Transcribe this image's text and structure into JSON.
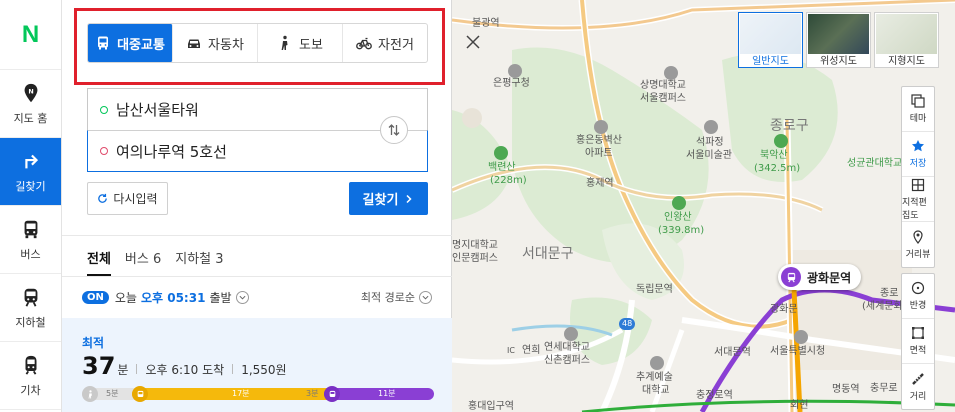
{
  "nav": {
    "logo": "N",
    "items": [
      {
        "label": "지도 홈",
        "icon": "map-pin-icon",
        "active": false
      },
      {
        "label": "길찾기",
        "icon": "directions-arrow-icon",
        "active": true
      },
      {
        "label": "버스",
        "icon": "bus-icon",
        "active": false
      },
      {
        "label": "지하철",
        "icon": "subway-icon",
        "active": false
      },
      {
        "label": "기차",
        "icon": "train-icon",
        "active": false
      }
    ]
  },
  "modes": [
    {
      "label": "대중교통",
      "icon": "bus-icon",
      "active": true
    },
    {
      "label": "자동차",
      "icon": "car-icon",
      "active": false
    },
    {
      "label": "도보",
      "icon": "walk-icon",
      "active": false
    },
    {
      "label": "자전거",
      "icon": "bicycle-icon",
      "active": false
    }
  ],
  "route": {
    "start": "남산서울타워",
    "goal": "여의나루역 5호선",
    "reset_label": "다시입력",
    "search_label": "길찾기"
  },
  "result_tabs": [
    {
      "label": "전체",
      "active": true
    },
    {
      "label": "버스 6",
      "active": false
    },
    {
      "label": "지하철 3",
      "active": false
    }
  ],
  "departure": {
    "badge": "ON",
    "prefix": "오늘",
    "time": "오후 05:31",
    "suffix": "출발",
    "sort_label": "최적 경로순"
  },
  "best_route": {
    "label": "최적",
    "minutes": "37",
    "minutes_unit": "분",
    "arrival": "오후 6:10 도착",
    "fare": "1,550원",
    "segments": [
      {
        "type": "walk",
        "label": "5분"
      },
      {
        "type": "bus",
        "label": "17분"
      },
      {
        "type": "walk",
        "label": "3분"
      },
      {
        "type": "subway",
        "label": "11분"
      }
    ]
  },
  "map": {
    "types": [
      {
        "label": "일반지도",
        "active": true
      },
      {
        "label": "위성지도",
        "active": false
      },
      {
        "label": "지형지도",
        "active": false
      }
    ],
    "tools_group1": [
      {
        "label": "테마",
        "icon": "layers-icon"
      },
      {
        "label": "저장",
        "icon": "star-icon"
      },
      {
        "label": "지적편집도",
        "icon": "cadastral-icon"
      },
      {
        "label": "거리뷰",
        "icon": "street-view-icon"
      }
    ],
    "tools_group2": [
      {
        "label": "반경",
        "icon": "radius-icon"
      },
      {
        "label": "면적",
        "icon": "area-icon"
      },
      {
        "label": "거리",
        "icon": "ruler-icon"
      }
    ],
    "station_pin": "광화문역",
    "labels": {
      "l01": "불광역",
      "l02": "은평구청",
      "l03": "상명대학교",
      "l04": "서울캠퍼스",
      "l05": "종로구",
      "l06": "홍은동벽산",
      "l07": "아파트",
      "l08": "석파정",
      "l09": "서울미술관",
      "l10": "북악산",
      "l11": "(342.5m)",
      "l12": "성균관대학교",
      "l13": "백련산",
      "l14": "(228m)",
      "l15": "홍제역",
      "l16": "인왕산",
      "l17": "(339.8m)",
      "l18": "서대문구",
      "l19": "명지대학교",
      "l20": "인문캠퍼스",
      "l21": "독립문역",
      "l22": "광화문",
      "l23": "종로",
      "l24": "(세계문화",
      "l25": "연세대학교",
      "l26": "신촌캠퍼스",
      "l27": "IC",
      "l28": "연희",
      "l29": "48",
      "l30": "서대문역",
      "l31": "서울특별시청",
      "l32": "추계예술",
      "l33": "대학교",
      "l34": "충정로역",
      "l35": "명동역",
      "l36": "충무로",
      "l37": "회현",
      "l38": "홍대입구역"
    }
  }
}
